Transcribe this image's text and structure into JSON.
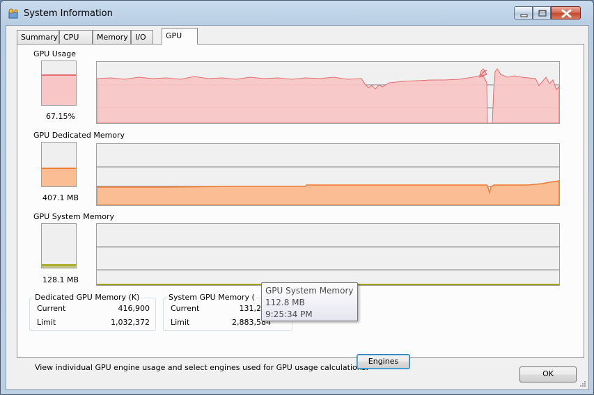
{
  "window": {
    "title": "System Information",
    "accent": "#c2442b"
  },
  "tabs": [
    {
      "label": "Summary"
    },
    {
      "label": "CPU"
    },
    {
      "label": "Memory"
    },
    {
      "label": "I/O"
    },
    {
      "label": "GPU",
      "active": true
    }
  ],
  "sections": {
    "usage": {
      "label": "GPU Usage",
      "value": "67.15%",
      "level": 0.6715,
      "color": "#f8c6c6",
      "line": "#e26d6d"
    },
    "dedicated": {
      "label": "GPU Dedicated Memory",
      "value": "407.1 MB",
      "level": 0.39,
      "color": "#fbbd94",
      "line": "#ee7a33"
    },
    "system": {
      "label": "GPU System Memory",
      "value": "128.1 MB",
      "level": 0.04,
      "color": "#c3c385",
      "line": "#a3a312"
    }
  },
  "dedicated_group": {
    "title": "Dedicated GPU Memory (K)",
    "rows": [
      {
        "label": "Current",
        "value": "416,900"
      },
      {
        "label": "Limit",
        "value": "1,032,372"
      }
    ]
  },
  "system_group": {
    "title": "System GPU Memory (",
    "rows": [
      {
        "label": "Current",
        "value": "131,204"
      },
      {
        "label": "Limit",
        "value": "2,883,584"
      }
    ]
  },
  "hint": "View individual GPU engine usage and select engines used for GPU usage calculations:",
  "buttons": {
    "engines": "Engines",
    "ok": "OK"
  },
  "tooltip": {
    "title": "GPU System Memory",
    "value": "112.8 MB",
    "time": "9:25:34 PM"
  }
}
